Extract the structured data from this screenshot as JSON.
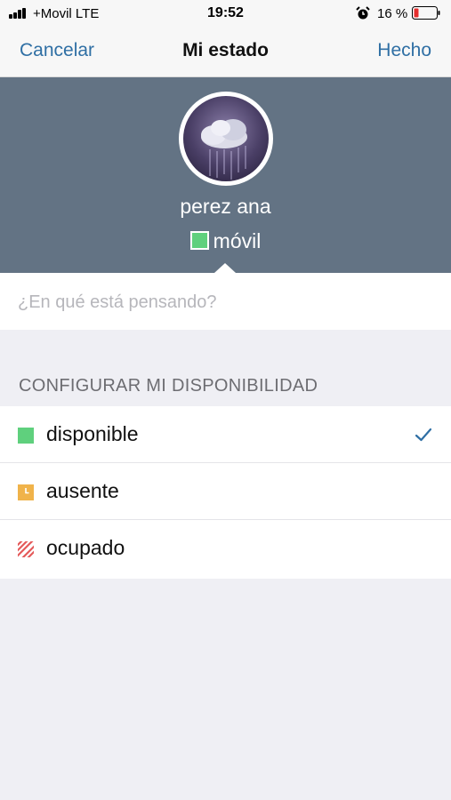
{
  "status_bar": {
    "carrier": "+Movil  LTE",
    "time": "19:52",
    "battery_pct": "16 %"
  },
  "nav": {
    "cancel_label": "Cancelar",
    "title": "Mi estado",
    "done_label": "Hecho"
  },
  "profile": {
    "name": "perez ana",
    "presence_label": "móvil",
    "presence_color": "#5fd07d"
  },
  "status_message": {
    "value": "",
    "placeholder": "¿En qué está pensando?"
  },
  "availability": {
    "header": "CONFIGURAR MI DISPONIBILIDAD",
    "options": [
      {
        "label": "disponible",
        "icon": "available-square-icon",
        "color": "#5fd07d",
        "selected": true
      },
      {
        "label": "ausente",
        "icon": "away-clock-icon",
        "color": "#f0b34a",
        "selected": false
      },
      {
        "label": "ocupado",
        "icon": "busy-striped-icon",
        "color": "#e45a5a",
        "selected": false
      }
    ]
  },
  "colors": {
    "accent": "#2f6fa4",
    "header_bg": "#637384"
  }
}
